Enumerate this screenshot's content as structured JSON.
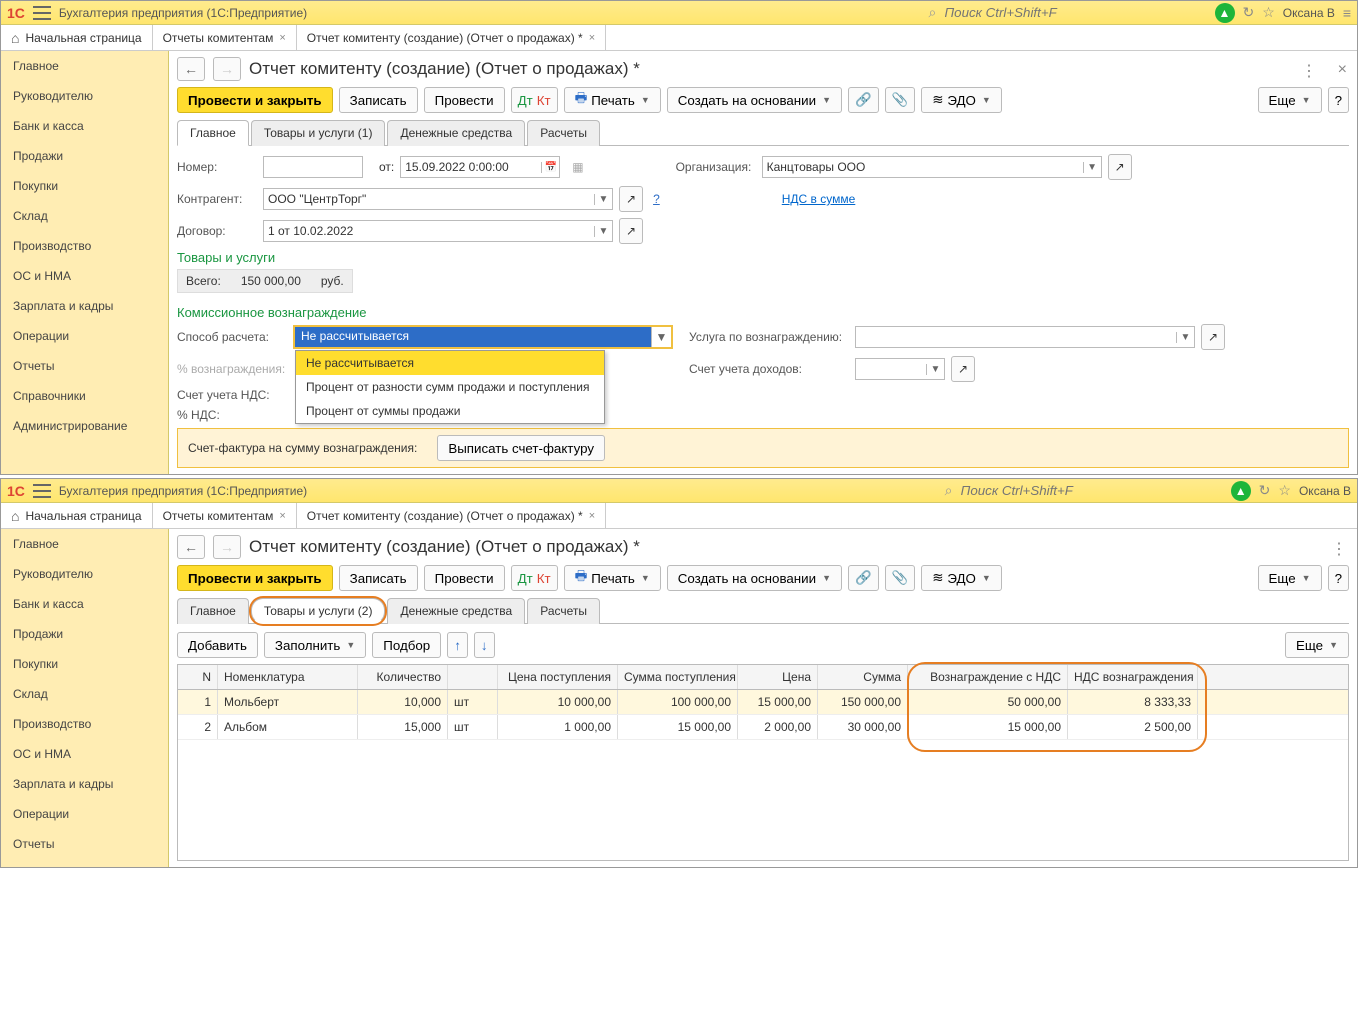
{
  "app": {
    "title": "Бухгалтерия предприятия  (1С:Предприятие)",
    "search_placeholder": "Поиск Ctrl+Shift+F",
    "username": "Оксана В"
  },
  "maintabs": {
    "home": "Начальная страница",
    "t1": "Отчеты комитентам",
    "t2": "Отчет комитенту (создание) (Отчет о продажах) *"
  },
  "sidebar": {
    "items": [
      "Главное",
      "Руководителю",
      "Банк и касса",
      "Продажи",
      "Покупки",
      "Склад",
      "Производство",
      "ОС и НМА",
      "Зарплата и кадры",
      "Операции",
      "Отчеты",
      "Справочники",
      "Администрирование"
    ]
  },
  "page": {
    "title": "Отчет комитенту (создание) (Отчет о продажах) *",
    "btn_post_close": "Провести и закрыть",
    "btn_save": "Записать",
    "btn_post": "Провести",
    "btn_print": "Печать",
    "btn_create_based": "Создать на основании",
    "btn_edo": "ЭДО",
    "btn_more": "Еще",
    "inner_tabs1": [
      "Главное",
      "Товары и услуги (1)",
      "Денежные средства",
      "Расчеты"
    ],
    "inner_tabs2": [
      "Главное",
      "Товары и услуги (2)",
      "Денежные средства",
      "Расчеты"
    ],
    "lbl_number": "Номер:",
    "lbl_from": "от:",
    "date_value": "15.09.2022  0:00:00",
    "lbl_org": "Организация:",
    "org_value": "Канцтовары ООО",
    "lbl_contr": "Контрагент:",
    "contr_value": "ООО \"ЦентрТорг\"",
    "link_vat": "НДС в сумме",
    "lbl_contract": "Договор:",
    "contract_value": "1 от 10.02.2022",
    "section_goods": "Товары и услуги",
    "lbl_total": "Всего:",
    "total_value": "150 000,00",
    "total_currency": "руб.",
    "section_fee": "Комиссионное вознаграждение",
    "lbl_method": "Способ расчета:",
    "method_value": "Не рассчитывается",
    "method_options": [
      "Не рассчитывается",
      "Процент от разности сумм продажи и поступления",
      "Процент от суммы продажи"
    ],
    "lbl_fee_service": "Услуга по вознаграждению:",
    "lbl_pct": "% вознаграждения:",
    "lbl_income_acc": "Счет учета доходов:",
    "lbl_vat_acc": "Счет учета НДС:",
    "lbl_vat_pct": "% НДС:",
    "lbl_invoice_amount": "Счет-фактура на сумму вознаграждения:",
    "btn_write_invoice": "Выписать счет-фактуру"
  },
  "goods_toolbar": {
    "add": "Добавить",
    "fill": "Заполнить",
    "pick": "Подбор",
    "more": "Еще"
  },
  "grid": {
    "headers": [
      "N",
      "Номенклатура",
      "Количество",
      "",
      "Цена поступления",
      "Сумма поступления",
      "Цена",
      "Сумма",
      "Вознаграждение с НДС",
      "НДС вознаграждения"
    ],
    "rows": [
      {
        "n": "1",
        "nom": "Мольберт",
        "qty": "10,000",
        "unit": "шт",
        "pr": "10 000,00",
        "sr": "100 000,00",
        "price": "15 000,00",
        "sum": "150 000,00",
        "fee": "50 000,00",
        "vat": "8 333,33"
      },
      {
        "n": "2",
        "nom": "Альбом",
        "qty": "15,000",
        "unit": "шт",
        "pr": "1 000,00",
        "sr": "15 000,00",
        "price": "2 000,00",
        "sum": "30 000,00",
        "fee": "15 000,00",
        "vat": "2 500,00"
      }
    ]
  }
}
